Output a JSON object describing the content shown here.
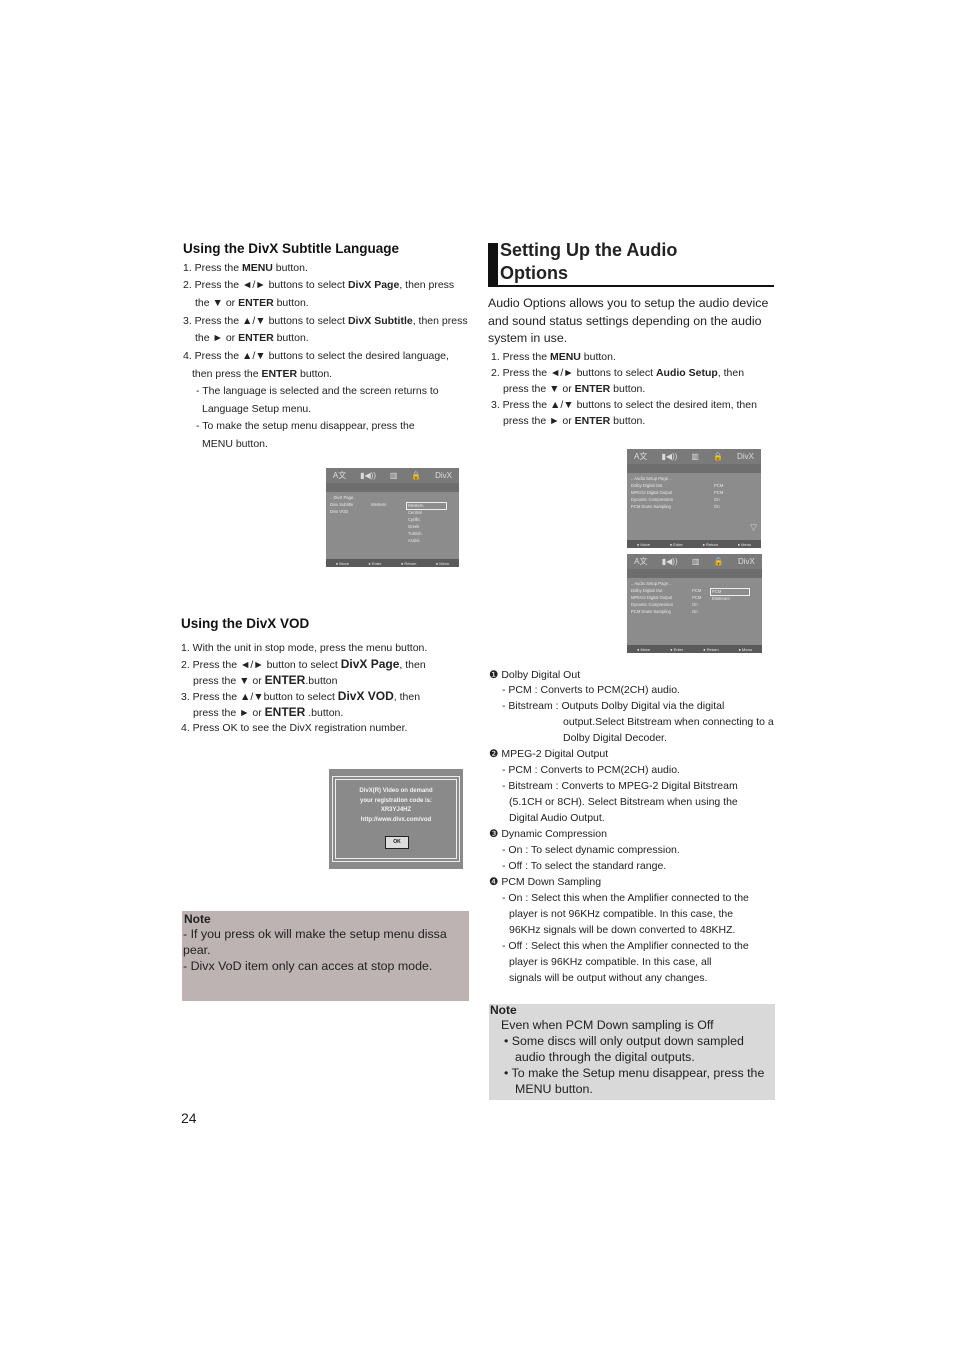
{
  "subtitle": {
    "title": "Using the DivX Subtitle Language",
    "lines": [
      [
        "1. Press the ",
        {
          "b": "MENU"
        },
        " button."
      ],
      [
        "2. Press the ◄/► buttons to select ",
        {
          "b": "DivX  Page"
        },
        ", then press"
      ],
      [
        "the ▼ or ",
        {
          "b": "ENTER"
        },
        " button."
      ],
      [
        "3. Press the ▲/▼ buttons to select ",
        {
          "b": "DivX Subtitle"
        },
        ", then press"
      ],
      [
        "the ►  or ",
        {
          "b": "ENTER"
        },
        " button."
      ],
      [
        "4. Press the ▲/▼ buttons to select the desired  language,"
      ],
      [
        "then press the ",
        {
          "b": "ENTER"
        },
        " button."
      ],
      [
        "- The language is selected and the screen returns to"
      ],
      [
        "Language Setup menu."
      ],
      [
        "- To make the setup menu disappear, press the"
      ],
      [
        "MENU button."
      ]
    ]
  },
  "screen_subtitle": {
    "icons": [
      "A文",
      "▮◀))",
      "▥",
      "🔒",
      "DivX"
    ],
    "page": ".. DivX Page..",
    "rows": [
      [
        "Divx Subtitle",
        "Western"
      ],
      [
        "Divx VOD",
        ""
      ]
    ],
    "options": [
      "Western",
      "Central",
      "Cyrillic",
      "Greek",
      "Turkish",
      "Arabic"
    ],
    "footer": [
      "Move",
      "Enter",
      "Return",
      "Menu"
    ]
  },
  "vod": {
    "title": "Using the DivX VOD",
    "lines": [
      [
        "1. With the unit in stop mode, press the menu button."
      ],
      [
        "2. Press the  ◄/► button  to select  ",
        {
          "b": "DivX Page"
        },
        ", then"
      ],
      [
        "press the ▼ or ",
        {
          "b": "ENTER"
        },
        ".button"
      ],
      [
        "3. Press the ▲/▼button  to select  ",
        {
          "b": "DivX VOD"
        },
        ", then"
      ],
      [
        "press the ► or ",
        {
          "b": "ENTER"
        },
        " .button."
      ],
      [
        "4. Press OK to see the DivX registration number."
      ]
    ]
  },
  "vod_dialog": {
    "lines": [
      "DivX(R) Video on demand",
      "your registration  code is:",
      "XR3YJ4HZ",
      "http://www.divx.com/vod"
    ],
    "ok": "OK"
  },
  "note_left": {
    "title": "Note",
    "lines": [
      "- If you press ok will make the setup menu dissa",
      "  pear.",
      "- Divx VoD item only can acces at stop mode."
    ]
  },
  "page_number": "24",
  "audio": {
    "title_line1": "Setting Up the Audio",
    "title_line2": "Options",
    "intro": [
      "Audio Options allows you to setup the audio device",
      "and sound status settings depending on the audio",
      "system in use."
    ],
    "lines": [
      [
        "1. Press the ",
        {
          "b": "MENU"
        },
        " button."
      ],
      [
        "2. Press the ◄/► buttons to select ",
        {
          "b": "Audio Setup"
        },
        ", then"
      ],
      [
        "press     the ▼ or ",
        {
          "b": "ENTER"
        },
        " button."
      ],
      [
        "3. Press the ▲/▼ buttons to select the desired item, then"
      ],
      [
        "press the ► or ",
        {
          "b": "ENTER"
        },
        " button."
      ]
    ],
    "details": [
      [
        "❶ Dolby Digital Out"
      ],
      [
        "- PCM : Converts to PCM(2CH) audio."
      ],
      [
        "- Bitstream : Outputs Dolby Digital via the digital"
      ],
      [
        "output.Select Bitstream when connecting to a"
      ],
      [
        "Dolby Digital Decoder."
      ],
      [
        "❷ MPEG-2 Digital Output"
      ],
      [
        "- PCM : Converts to PCM(2CH) audio."
      ],
      [
        "- Bitstream : Converts to MPEG-2 Digital Bitstream"
      ],
      [
        "(5.1CH or 8CH). Select Bitstream when using the"
      ],
      [
        "Digital Audio Output."
      ],
      [
        "❸ Dynamic Compression"
      ],
      [
        "- On : To select dynamic compression."
      ],
      [
        "- Off : To select the standard range."
      ],
      [
        "❹ PCM Down Sampling"
      ],
      [
        "- On : Select this when the Amplifier connected to the"
      ],
      [
        "player is not 96KHz compatible. In this case, the"
      ],
      [
        "96KHz signals will be down converted to 48KHZ."
      ],
      [
        "- Off : Select this when the Amplifier connected to the"
      ],
      [
        "player is 96KHz compatible. In this case, all"
      ],
      [
        "signals will be output without any changes."
      ]
    ]
  },
  "screen_audio1": {
    "icons": [
      "A文",
      "▮◀))",
      "▥",
      "🔒",
      "DivX"
    ],
    "page": ".. Audio Setup Page ..",
    "rows": [
      [
        "Dolby  Digital Out",
        "PCM"
      ],
      [
        "MPEG2 Digital Output",
        "PCM"
      ],
      [
        "Dynamic Compression",
        "On"
      ],
      [
        "PCM Down Sampling",
        "On"
      ]
    ],
    "options": [],
    "footer": [
      "Move",
      "Enter",
      "Return",
      "Menu"
    ]
  },
  "screen_audio2": {
    "icons": [
      "A文",
      "▮◀))",
      "▥",
      "🔒",
      "DivX"
    ],
    "page": ".. Audio Setup Page ..",
    "rows": [
      [
        "Dolby  Digital Out",
        "PCM"
      ],
      [
        "MPEG2 Digital Output",
        "PCM"
      ],
      [
        "Dynamic Compression",
        "On"
      ],
      [
        "PCM Down Sampling",
        "On"
      ]
    ],
    "options": [
      "PCM",
      "Bitstream"
    ],
    "footer": [
      "Move",
      "Enter",
      "Return",
      "Menu"
    ]
  },
  "note_right": {
    "title": "Note",
    "lines": [
      "Even when PCM Down sampling is Off",
      "• Some discs will only output down sampled",
      "audio through the digital outputs.",
      "• To make the Setup menu disappear, press the",
      "MENU button."
    ]
  },
  "colors": {
    "note_left_bg": "#bdb3b3",
    "note_right_bg": "#d9d9d9",
    "screen_bg": "#8c8c8c"
  }
}
